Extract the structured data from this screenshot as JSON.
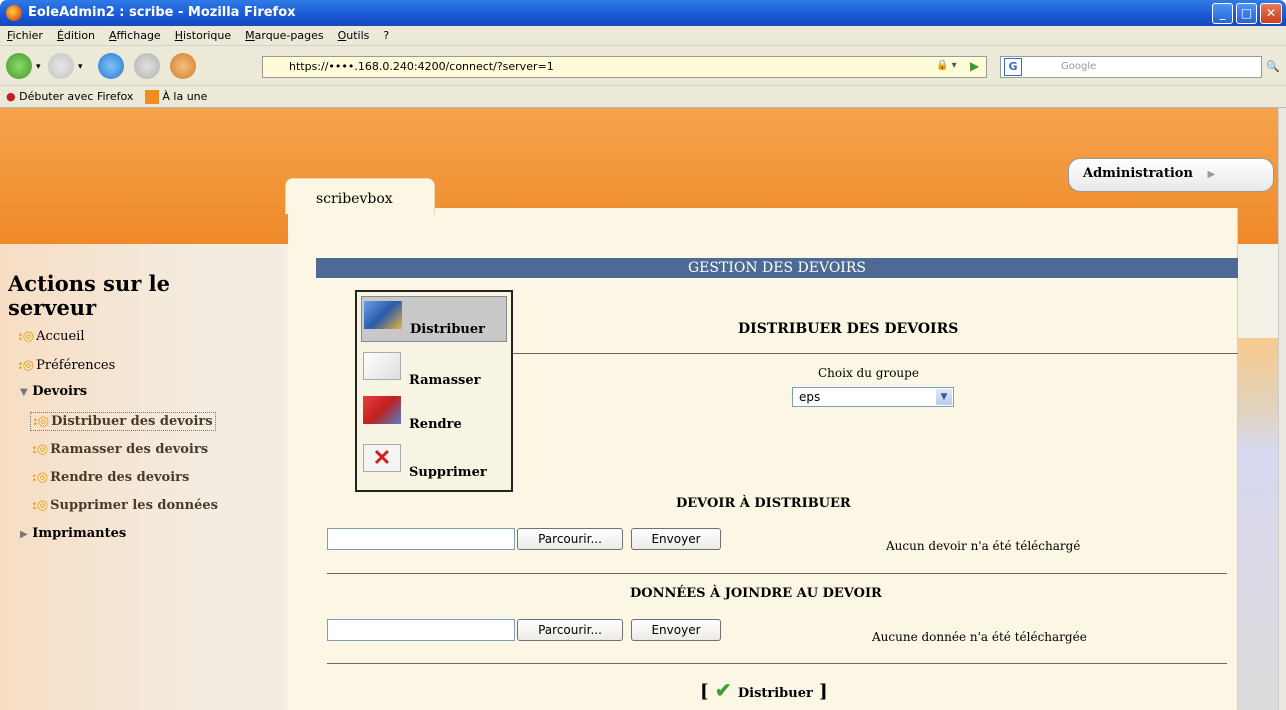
{
  "window": {
    "title": "EoleAdmin2 : scribe - Mozilla Firefox"
  },
  "menu": [
    "Fichier",
    "Édition",
    "Affichage",
    "Historique",
    "Marque-pages",
    "Outils",
    "?"
  ],
  "url": "https://••••.168.0.240:4200/connect/?server=1",
  "search_placeholder": "Google",
  "bookmarks": [
    "Débuter avec Firefox",
    "À la une"
  ],
  "header": {
    "tab": "scribevbox",
    "admin_button": "Administration"
  },
  "sidebar": {
    "title_line1": "Actions sur le",
    "title_line2": "serveur",
    "items": [
      {
        "label": "Accueil"
      },
      {
        "label": "Préférences"
      },
      {
        "label": "Devoirs"
      },
      {
        "label": "Imprimantes"
      }
    ],
    "subitems": [
      {
        "label": "Distribuer des devoirs"
      },
      {
        "label": "Ramasser des devoirs"
      },
      {
        "label": "Rendre des devoirs"
      },
      {
        "label": "Supprimer les données"
      }
    ]
  },
  "main": {
    "section_title": "GESTION DES DEVOIRS",
    "actions": [
      "Distribuer",
      "Ramasser",
      "Rendre",
      "Supprimer"
    ],
    "form_title": "DISTRIBUER DES DEVOIRS",
    "group_label": "Choix du groupe",
    "group_value": "eps",
    "devoir_title": "DEVOIR À DISTRIBUER",
    "data_title": "DONNÉES À JOINDRE AU DEVOIR",
    "browse_label": "Parcourir...",
    "send_label": "Envoyer",
    "devoir_status": "Aucun devoir n'a été téléchargé",
    "data_status": "Aucune donnée n'a été téléchargée",
    "submit_open": "[",
    "submit_label": "Distribuer",
    "submit_close": "]"
  }
}
